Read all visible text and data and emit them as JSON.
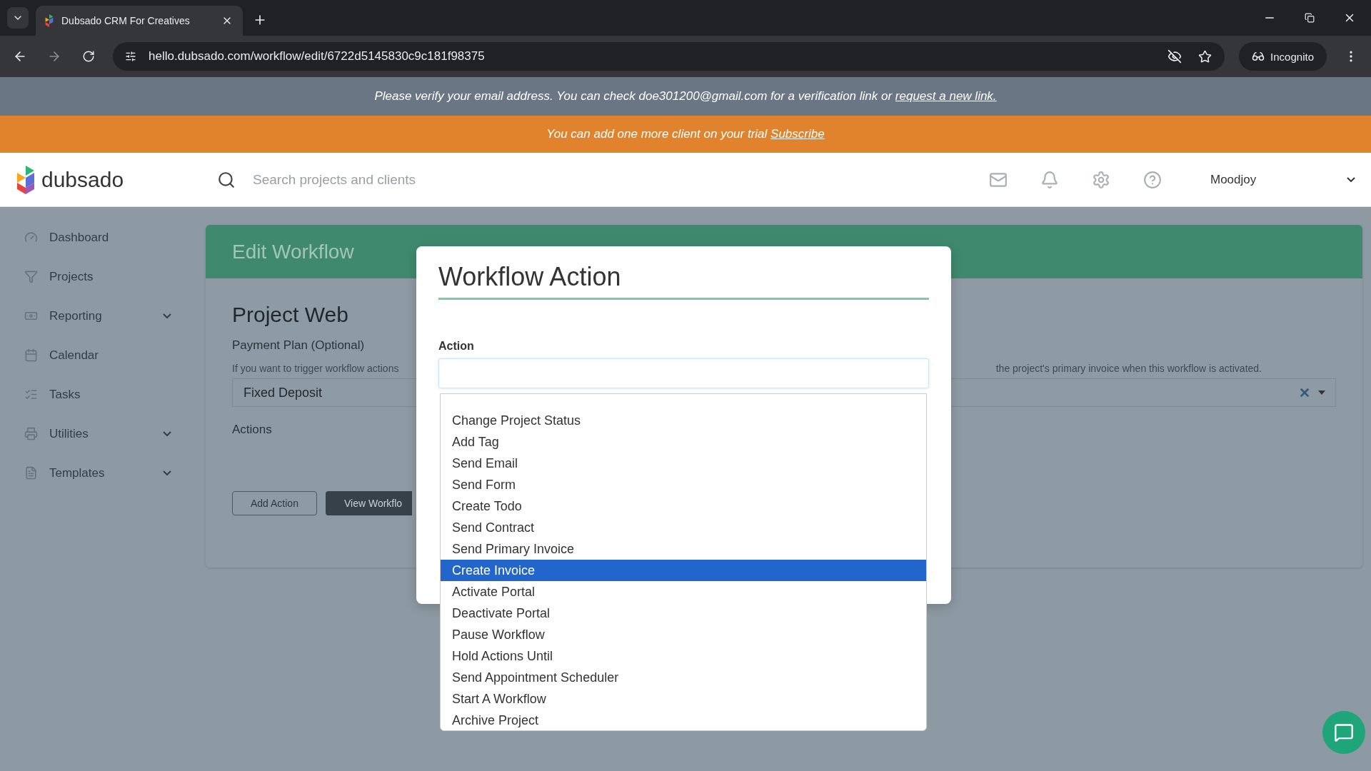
{
  "browser": {
    "tab_title": "Dubsado CRM For Creatives",
    "url": "hello.dubsado.com/workflow/edit/6722d5145830c9c181f98375",
    "incognito_label": "Incognito"
  },
  "banners": {
    "verify_text": "Please verify your email address. You can check doe301200@gmail.com for a verification link or",
    "verify_link": "request a new link.",
    "trial_text": "You can add one more client on your trial",
    "trial_link": "Subscribe"
  },
  "header": {
    "logo_text": "dubsado",
    "search_placeholder": "Search projects and clients",
    "user_name": "Moodjoy"
  },
  "sidebar": {
    "items": [
      {
        "label": "Dashboard",
        "expandable": false
      },
      {
        "label": "Projects",
        "expandable": false
      },
      {
        "label": "Reporting",
        "expandable": true
      },
      {
        "label": "Calendar",
        "expandable": false
      },
      {
        "label": "Tasks",
        "expandable": false
      },
      {
        "label": "Utilities",
        "expandable": true
      },
      {
        "label": "Templates",
        "expandable": true
      }
    ]
  },
  "workflow": {
    "header_title": "Edit Workflow",
    "project_title": "Project Web",
    "payment_plan_label": "Payment Plan (Optional)",
    "helper_left": "If you want to trigger workflow actions",
    "helper_right": "the project's primary invoice when this workflow is activated.",
    "payment_plan_value": "Fixed Deposit",
    "actions_label": "Actions",
    "buttons": [
      {
        "label": "Add Action",
        "kind": "outline"
      },
      {
        "label": "View Workflo",
        "kind": "dark"
      }
    ]
  },
  "modal": {
    "title": "Workflow Action",
    "action_label": "Action",
    "options": [
      {
        "label": "Change Project Status",
        "selected": false
      },
      {
        "label": "Add Tag",
        "selected": false
      },
      {
        "label": "Send Email",
        "selected": false
      },
      {
        "label": "Send Form",
        "selected": false
      },
      {
        "label": "Create Todo",
        "selected": false
      },
      {
        "label": "Send Contract",
        "selected": false
      },
      {
        "label": "Send Primary Invoice",
        "selected": false
      },
      {
        "label": "Create Invoice",
        "selected": true
      },
      {
        "label": "Activate Portal",
        "selected": false
      },
      {
        "label": "Deactivate Portal",
        "selected": false
      },
      {
        "label": "Pause Workflow",
        "selected": false
      },
      {
        "label": "Hold Actions Until",
        "selected": false
      },
      {
        "label": "Send Appointment Scheduler",
        "selected": false
      },
      {
        "label": "Start A Workflow",
        "selected": false
      },
      {
        "label": "Archive Project",
        "selected": false
      }
    ]
  }
}
